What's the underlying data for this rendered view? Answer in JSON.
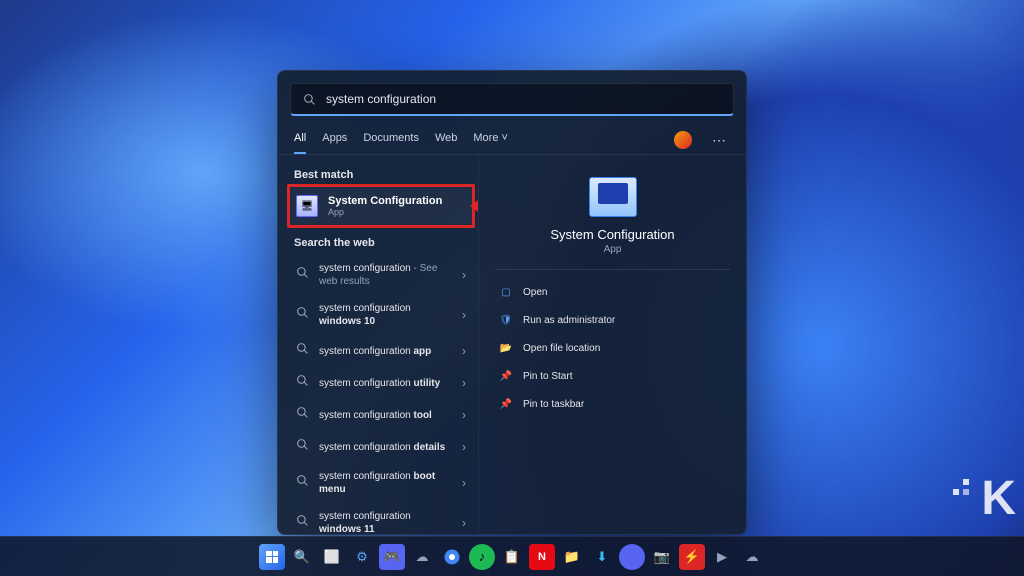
{
  "search": {
    "query": "system configuration"
  },
  "tabs": {
    "all": "All",
    "apps": "Apps",
    "documents": "Documents",
    "web": "Web",
    "more": "More"
  },
  "sections": {
    "best_match": "Best match",
    "search_web": "Search the web"
  },
  "best_match": {
    "title": "System Configuration",
    "subtitle": "App"
  },
  "web_results": [
    {
      "prefix": "system configuration",
      "suffix": " - See web results",
      "bold": ""
    },
    {
      "prefix": "system configuration ",
      "suffix": "",
      "bold": "windows 10"
    },
    {
      "prefix": "system configuration ",
      "suffix": "",
      "bold": "app"
    },
    {
      "prefix": "system configuration ",
      "suffix": "",
      "bold": "utility"
    },
    {
      "prefix": "system configuration ",
      "suffix": "",
      "bold": "tool"
    },
    {
      "prefix": "system configuration ",
      "suffix": "",
      "bold": "details"
    },
    {
      "prefix": "system configuration ",
      "suffix": "",
      "bold": "boot menu"
    },
    {
      "prefix": "system configuration ",
      "suffix": "",
      "bold": "windows 11"
    }
  ],
  "preview": {
    "title": "System Configuration",
    "subtitle": "App",
    "actions": {
      "open": "Open",
      "run_admin": "Run as administrator",
      "open_location": "Open file location",
      "pin_start": "Pin to Start",
      "pin_taskbar": "Pin to taskbar"
    }
  },
  "watermark": "K"
}
